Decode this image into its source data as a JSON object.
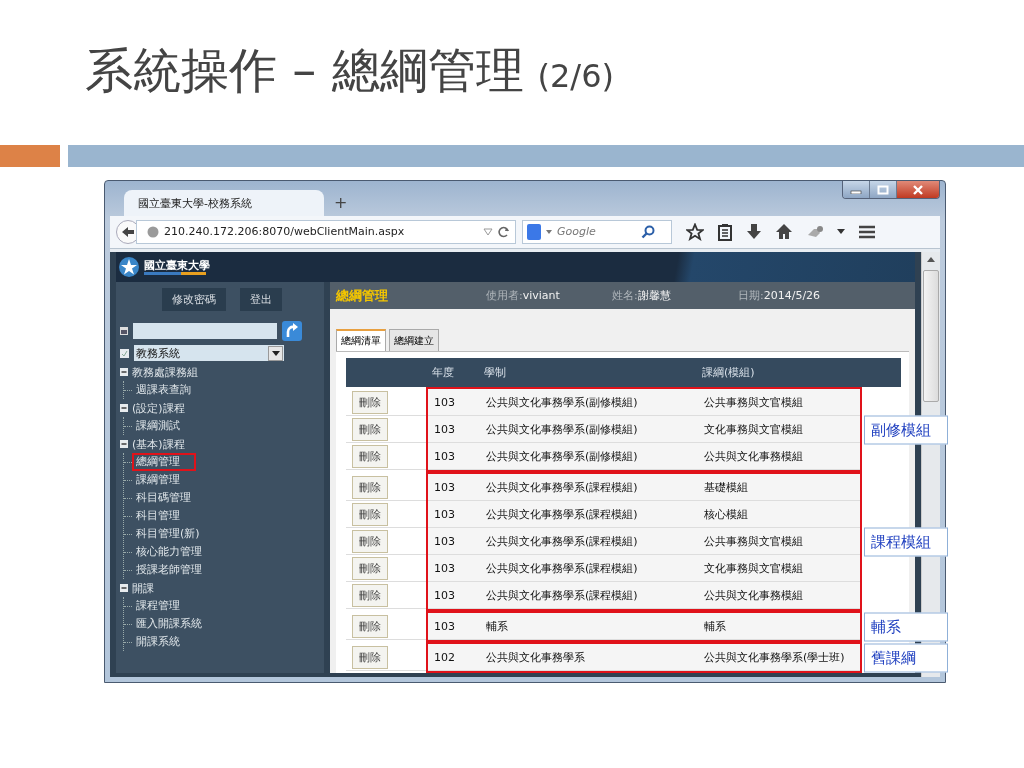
{
  "slide": {
    "title": "系統操作 – 總綱管理",
    "page": "(2/6)"
  },
  "browser": {
    "tabs": [
      {
        "title": "國立臺東大學-校務系統",
        "selected": true
      }
    ],
    "new_tab": "+",
    "url": "210.240.172.206:8070/webClientMain.aspx",
    "search": {
      "placeholder": "Google"
    }
  },
  "banner": {
    "logo_text": "國立臺東大學"
  },
  "sidebar": {
    "buttons": [
      "修改密碼",
      "登出"
    ],
    "system_select": {
      "value": "教務系統"
    },
    "tree": [
      {
        "label": "教務處課務組",
        "expanded": true,
        "children": [
          {
            "label": "週課表查詢",
            "highlighted": false
          }
        ]
      },
      {
        "label": "(設定)課程",
        "expanded": true,
        "children": [
          {
            "label": "課綱測試",
            "highlighted": false
          }
        ]
      },
      {
        "label": "(基本)課程",
        "expanded": true,
        "children": [
          {
            "label": "總綱管理",
            "highlighted": true
          },
          {
            "label": "課綱管理",
            "highlighted": false
          },
          {
            "label": "科目碼管理",
            "highlighted": false
          },
          {
            "label": "科目管理",
            "highlighted": false
          },
          {
            "label": "科目管理(新)",
            "highlighted": false
          },
          {
            "label": "核心能力管理",
            "highlighted": false
          },
          {
            "label": "授課老師管理",
            "highlighted": false
          }
        ]
      },
      {
        "label": "開課",
        "expanded": true,
        "children": [
          {
            "label": "課程管理",
            "highlighted": false
          },
          {
            "label": "匯入開課系統",
            "highlighted": false
          },
          {
            "label": "開課系統",
            "highlighted": false
          }
        ]
      }
    ]
  },
  "main": {
    "title": "總綱管理",
    "fields": [
      {
        "label": "使用者:",
        "value": "viviant"
      },
      {
        "label": "姓名:",
        "value": "謝馨慧"
      },
      {
        "label": "日期:",
        "value": "2014/5/26"
      }
    ],
    "tabs": [
      {
        "label": "總綱清單",
        "selected": true
      },
      {
        "label": "總綱建立",
        "selected": false
      }
    ],
    "table": {
      "columns": [
        "年度",
        "學制",
        "課綱(模組)"
      ],
      "groups": [
        {
          "label": "副修模組",
          "rows": [
            {
              "action": "刪除",
              "year": "103",
              "program": "公共與文化事務學系(副修模組)",
              "course": "公共事務與文官模組"
            },
            {
              "action": "刪除",
              "year": "103",
              "program": "公共與文化事務學系(副修模組)",
              "course": "文化事務與文官模組"
            },
            {
              "action": "刪除",
              "year": "103",
              "program": "公共與文化事務學系(副修模組)",
              "course": "公共與文化事務模組"
            }
          ]
        },
        {
          "label": "課程模組",
          "rows": [
            {
              "action": "刪除",
              "year": "103",
              "program": "公共與文化事務學系(課程模組)",
              "course": "基礎模組"
            },
            {
              "action": "刪除",
              "year": "103",
              "program": "公共與文化事務學系(課程模組)",
              "course": "核心模組"
            },
            {
              "action": "刪除",
              "year": "103",
              "program": "公共與文化事務學系(課程模組)",
              "course": "公共事務與文官模組"
            },
            {
              "action": "刪除",
              "year": "103",
              "program": "公共與文化事務學系(課程模組)",
              "course": "文化事務與文官模組"
            },
            {
              "action": "刪除",
              "year": "103",
              "program": "公共與文化事務學系(課程模組)",
              "course": "公共與文化事務模組"
            }
          ]
        },
        {
          "label": "輔系",
          "rows": [
            {
              "action": "刪除",
              "year": "103",
              "program": "輔系",
              "course": "輔系"
            }
          ]
        },
        {
          "label": "舊課綱",
          "rows": [
            {
              "action": "刪除",
              "year": "102",
              "program": "公共與文化事務學系",
              "course": "公共與文化事務學系(學士班)"
            }
          ]
        }
      ]
    }
  }
}
